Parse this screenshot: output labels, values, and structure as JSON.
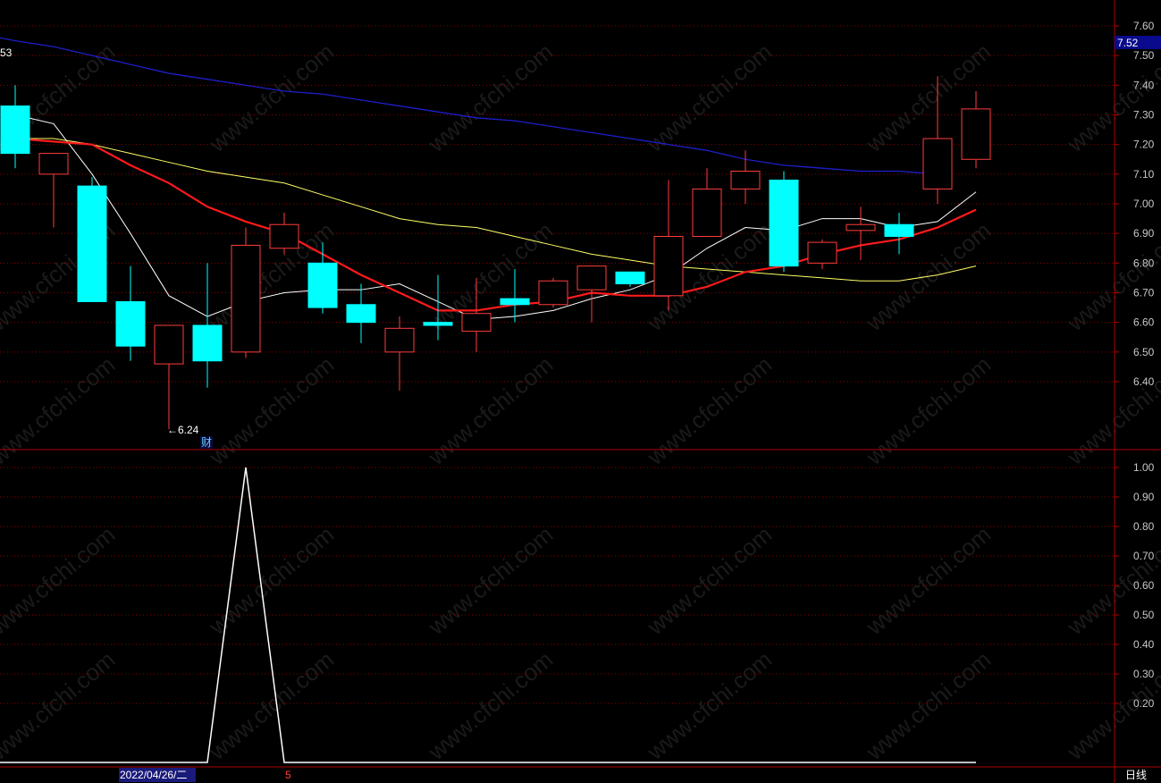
{
  "colors": {
    "up": "#ff3c3c",
    "down": "#00ffff",
    "ma_white": "#ffffff",
    "ma_red": "#ff1a1a",
    "ma_yellow": "#ffff66",
    "ma_blue": "#1e1ecc",
    "grid": "#8b0000",
    "frame": "#b00000",
    "indicator": "#ffffff"
  },
  "watermark": "www.cfchi.com",
  "price_axis_ticks": [
    "7.60",
    "7.50",
    "7.40",
    "7.30",
    "7.20",
    "7.10",
    "7.00",
    "6.90",
    "6.80",
    "6.70",
    "6.60",
    "6.50",
    "6.40"
  ],
  "indicator_axis_ticks": [
    "1.00",
    "0.90",
    "0.80",
    "0.70",
    "0.60",
    "0.50",
    "0.40",
    "0.30",
    "0.20"
  ],
  "current_price_label": "7.52",
  "left_edge_label": "53",
  "low_marker": "←6.24",
  "finance_marker": "财",
  "date_label": "2022/04/26/二",
  "month_marker": "5",
  "period_label": "日线",
  "chart_data": [
    {
      "type": "candlestick",
      "ylim": [
        6.24,
        7.65
      ],
      "candles": [
        {
          "o": 7.33,
          "h": 7.4,
          "l": 7.12,
          "c": 7.17
        },
        {
          "o": 7.1,
          "h": 7.17,
          "l": 6.92,
          "c": 7.17
        },
        {
          "o": 7.06,
          "h": 7.09,
          "l": 6.67,
          "c": 6.67
        },
        {
          "o": 6.67,
          "h": 6.79,
          "l": 6.47,
          "c": 6.52
        },
        {
          "o": 6.46,
          "h": 6.59,
          "l": 6.24,
          "c": 6.59
        },
        {
          "o": 6.59,
          "h": 6.8,
          "l": 6.38,
          "c": 6.47
        },
        {
          "o": 6.5,
          "h": 6.92,
          "l": 6.48,
          "c": 6.86
        },
        {
          "o": 6.85,
          "h": 6.97,
          "l": 6.83,
          "c": 6.93
        },
        {
          "o": 6.8,
          "h": 6.87,
          "l": 6.63,
          "c": 6.65
        },
        {
          "o": 6.66,
          "h": 6.73,
          "l": 6.53,
          "c": 6.6
        },
        {
          "o": 6.5,
          "h": 6.62,
          "l": 6.37,
          "c": 6.58
        },
        {
          "o": 6.6,
          "h": 6.76,
          "l": 6.54,
          "c": 6.59
        },
        {
          "o": 6.57,
          "h": 6.75,
          "l": 6.5,
          "c": 6.63
        },
        {
          "o": 6.68,
          "h": 6.78,
          "l": 6.6,
          "c": 6.66
        },
        {
          "o": 6.66,
          "h": 6.75,
          "l": 6.65,
          "c": 6.74
        },
        {
          "o": 6.71,
          "h": 6.79,
          "l": 6.6,
          "c": 6.79
        },
        {
          "o": 6.77,
          "h": 6.77,
          "l": 6.72,
          "c": 6.73
        },
        {
          "o": 6.69,
          "h": 7.08,
          "l": 6.64,
          "c": 6.89
        },
        {
          "o": 6.89,
          "h": 7.12,
          "l": 6.89,
          "c": 7.05
        },
        {
          "o": 7.05,
          "h": 7.18,
          "l": 7.0,
          "c": 7.11
        },
        {
          "o": 7.08,
          "h": 7.11,
          "l": 6.77,
          "c": 6.79
        },
        {
          "o": 6.8,
          "h": 6.88,
          "l": 6.78,
          "c": 6.87
        },
        {
          "o": 6.91,
          "h": 6.99,
          "l": 6.81,
          "c": 6.93
        },
        {
          "o": 6.93,
          "h": 6.97,
          "l": 6.83,
          "c": 6.89
        },
        {
          "o": 7.05,
          "h": 7.43,
          "l": 7.0,
          "c": 7.22
        },
        {
          "o": 7.15,
          "h": 7.38,
          "l": 7.12,
          "c": 7.32
        }
      ],
      "ma_white": [
        7.3,
        7.27,
        7.1,
        6.9,
        6.69,
        6.62,
        6.67,
        6.7,
        6.71,
        6.71,
        6.73,
        6.67,
        6.61,
        6.62,
        6.64,
        6.68,
        6.71,
        6.76,
        6.85,
        6.92,
        6.91,
        6.95,
        6.95,
        6.92,
        6.94,
        7.04
      ],
      "ma_red": [
        7.22,
        7.21,
        7.2,
        7.13,
        7.07,
        6.99,
        6.94,
        6.9,
        6.83,
        6.76,
        6.7,
        6.64,
        6.64,
        6.66,
        6.67,
        6.7,
        6.69,
        6.69,
        6.72,
        6.77,
        6.79,
        6.83,
        6.86,
        6.88,
        6.92,
        6.98
      ],
      "ma_yellow": [
        7.22,
        7.22,
        7.2,
        7.17,
        7.14,
        7.11,
        7.09,
        7.07,
        7.03,
        6.99,
        6.95,
        6.93,
        6.92,
        6.89,
        6.86,
        6.83,
        6.81,
        6.79,
        6.78,
        6.77,
        6.76,
        6.75,
        6.74,
        6.74,
        6.76,
        6.79,
        6.84
      ],
      "ma_blue": [
        7.55,
        7.53,
        7.5,
        7.47,
        7.44,
        7.42,
        7.4,
        7.38,
        7.37,
        7.35,
        7.33,
        7.31,
        7.29,
        7.28,
        7.26,
        7.24,
        7.22,
        7.2,
        7.18,
        7.15,
        7.13,
        7.12,
        7.11,
        7.11,
        7.1
      ]
    },
    {
      "type": "line",
      "ylim": [
        0,
        1.0
      ],
      "values": [
        0,
        0,
        0,
        0,
        0,
        0,
        1,
        0,
        0,
        0,
        0,
        0,
        0,
        0,
        0,
        0,
        0,
        0,
        0,
        0,
        0,
        0,
        0,
        0,
        0,
        0
      ]
    }
  ]
}
